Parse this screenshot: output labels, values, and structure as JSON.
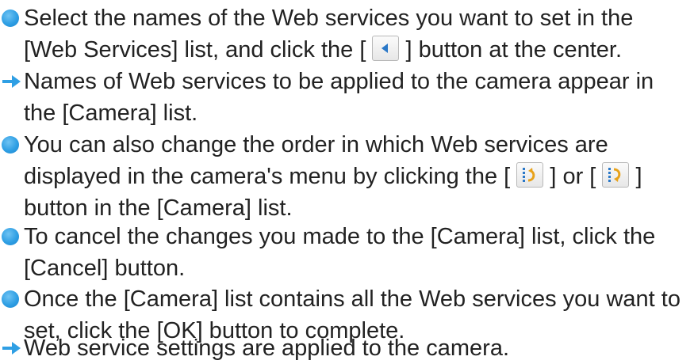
{
  "items": [
    {
      "marker": "bullet",
      "lines": [
        [
          "Select the names of the Web services you want to set in the"
        ],
        [
          "[Web Services] list, and click the [ ",
          {
            "icon": "arrow-left-icon"
          },
          " ] button at the center."
        ]
      ]
    },
    {
      "marker": "arrow",
      "lines": [
        [
          "Names of Web services to be applied to the camera appear in"
        ],
        [
          "the [Camera] list."
        ]
      ]
    },
    {
      "marker": "bullet",
      "lines": [
        [
          "You can also change the order in which Web services are"
        ],
        [
          "displayed in the camera's menu by clicking the [ ",
          {
            "icon": "move-up-icon"
          },
          " ] or [ ",
          {
            "icon": "move-down-icon"
          },
          " ]"
        ],
        [
          "button in the [Camera] list."
        ]
      ]
    },
    {
      "marker": "bullet",
      "lines": [
        [
          "To cancel the changes you made to the [Camera] list, click the"
        ],
        [
          "[Cancel] button."
        ]
      ]
    },
    {
      "marker": "bullet",
      "lines": [
        [
          "Once the [Camera] list contains all the Web services you want to"
        ],
        [
          "set, click the [OK] button to complete."
        ]
      ]
    },
    {
      "marker": "arrow",
      "lines": [
        [
          "Web service settings are applied to the camera."
        ]
      ]
    }
  ],
  "colors": {
    "bullet": "#2f9fe4",
    "arrow": "#2f9fe4",
    "text": "#222222"
  }
}
